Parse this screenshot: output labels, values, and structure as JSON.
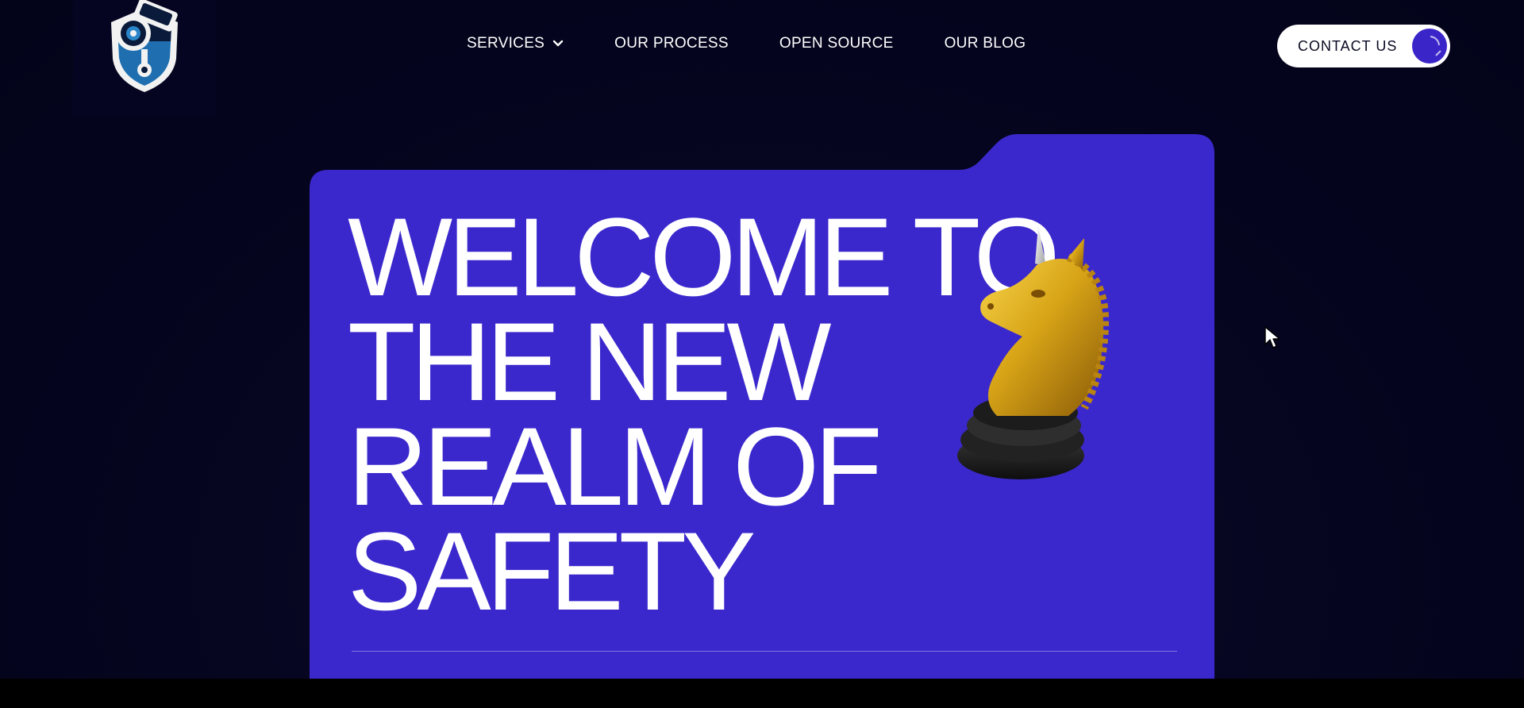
{
  "nav": {
    "items": [
      {
        "label": "SERVICES",
        "has_dropdown": true
      },
      {
        "label": "OUR PROCESS"
      },
      {
        "label": "OPEN SOURCE"
      },
      {
        "label": "OUR BLOG"
      }
    ]
  },
  "contact": {
    "label": "CONTACT US"
  },
  "hero": {
    "title_lines": [
      "WELCOME TO",
      "THE NEW",
      "REALM OF",
      "SAFETY"
    ]
  },
  "colors": {
    "background": "#03031a",
    "hero_card": "#3b28cc",
    "accent": "#3a25c9",
    "text": "#ffffff"
  },
  "icons": {
    "logo": "security-camera-shield-icon",
    "dropdown": "chevron-down-icon",
    "decoration": "golden-unicorn-chess-knight",
    "cursor": "mouse-pointer-icon"
  }
}
